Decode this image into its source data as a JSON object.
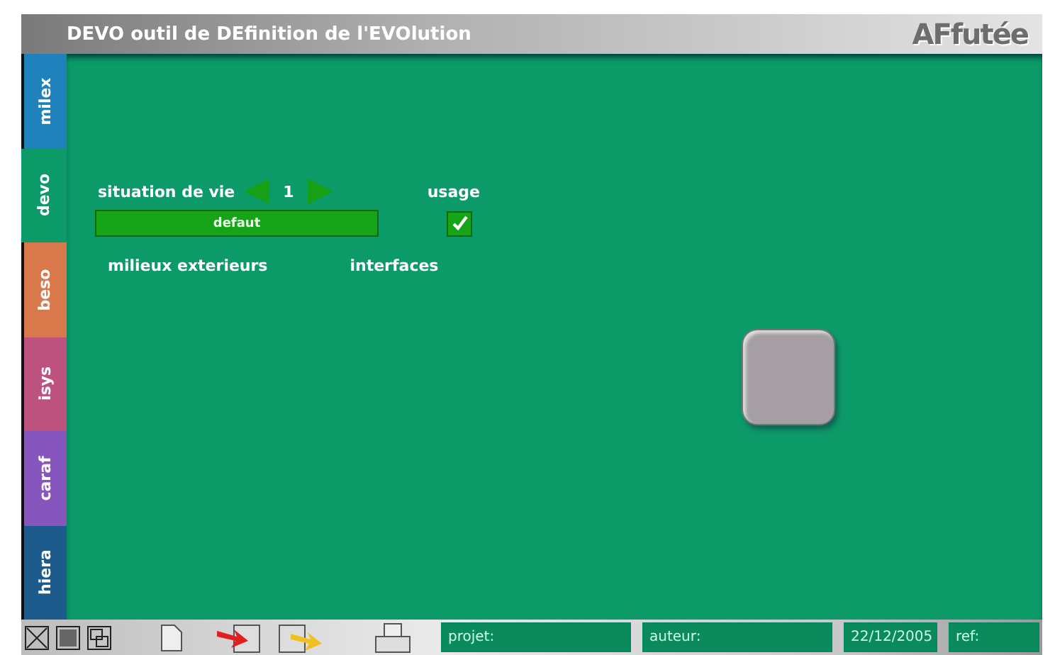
{
  "window": {
    "title": "DEVO outil de DEfinition de l'EVOlution",
    "logo": "AFfutée"
  },
  "tabs": [
    {
      "label": "milex",
      "selected": false,
      "color": "#1f82bc"
    },
    {
      "label": "devo",
      "selected": true,
      "color": "#0b9a68"
    },
    {
      "label": "beso",
      "selected": false,
      "color": "#d9784a"
    },
    {
      "label": "isys",
      "selected": false,
      "color": "#bd527e"
    },
    {
      "label": "caraf",
      "selected": false,
      "color": "#8756bd"
    },
    {
      "label": "hiera",
      "selected": false,
      "color": "#1d5b8c"
    }
  ],
  "situation": {
    "label": "situation de vie",
    "value": "1",
    "name": "defaut"
  },
  "usage": {
    "label": "usage",
    "checked": true
  },
  "sections": [
    "milieux exterieurs",
    "interfaces"
  ],
  "status_bar": {
    "fields": [
      {
        "label": "projet:"
      },
      {
        "label": "auteur:"
      },
      {
        "label": "22/12/2005"
      },
      {
        "label": "ref:"
      }
    ]
  }
}
